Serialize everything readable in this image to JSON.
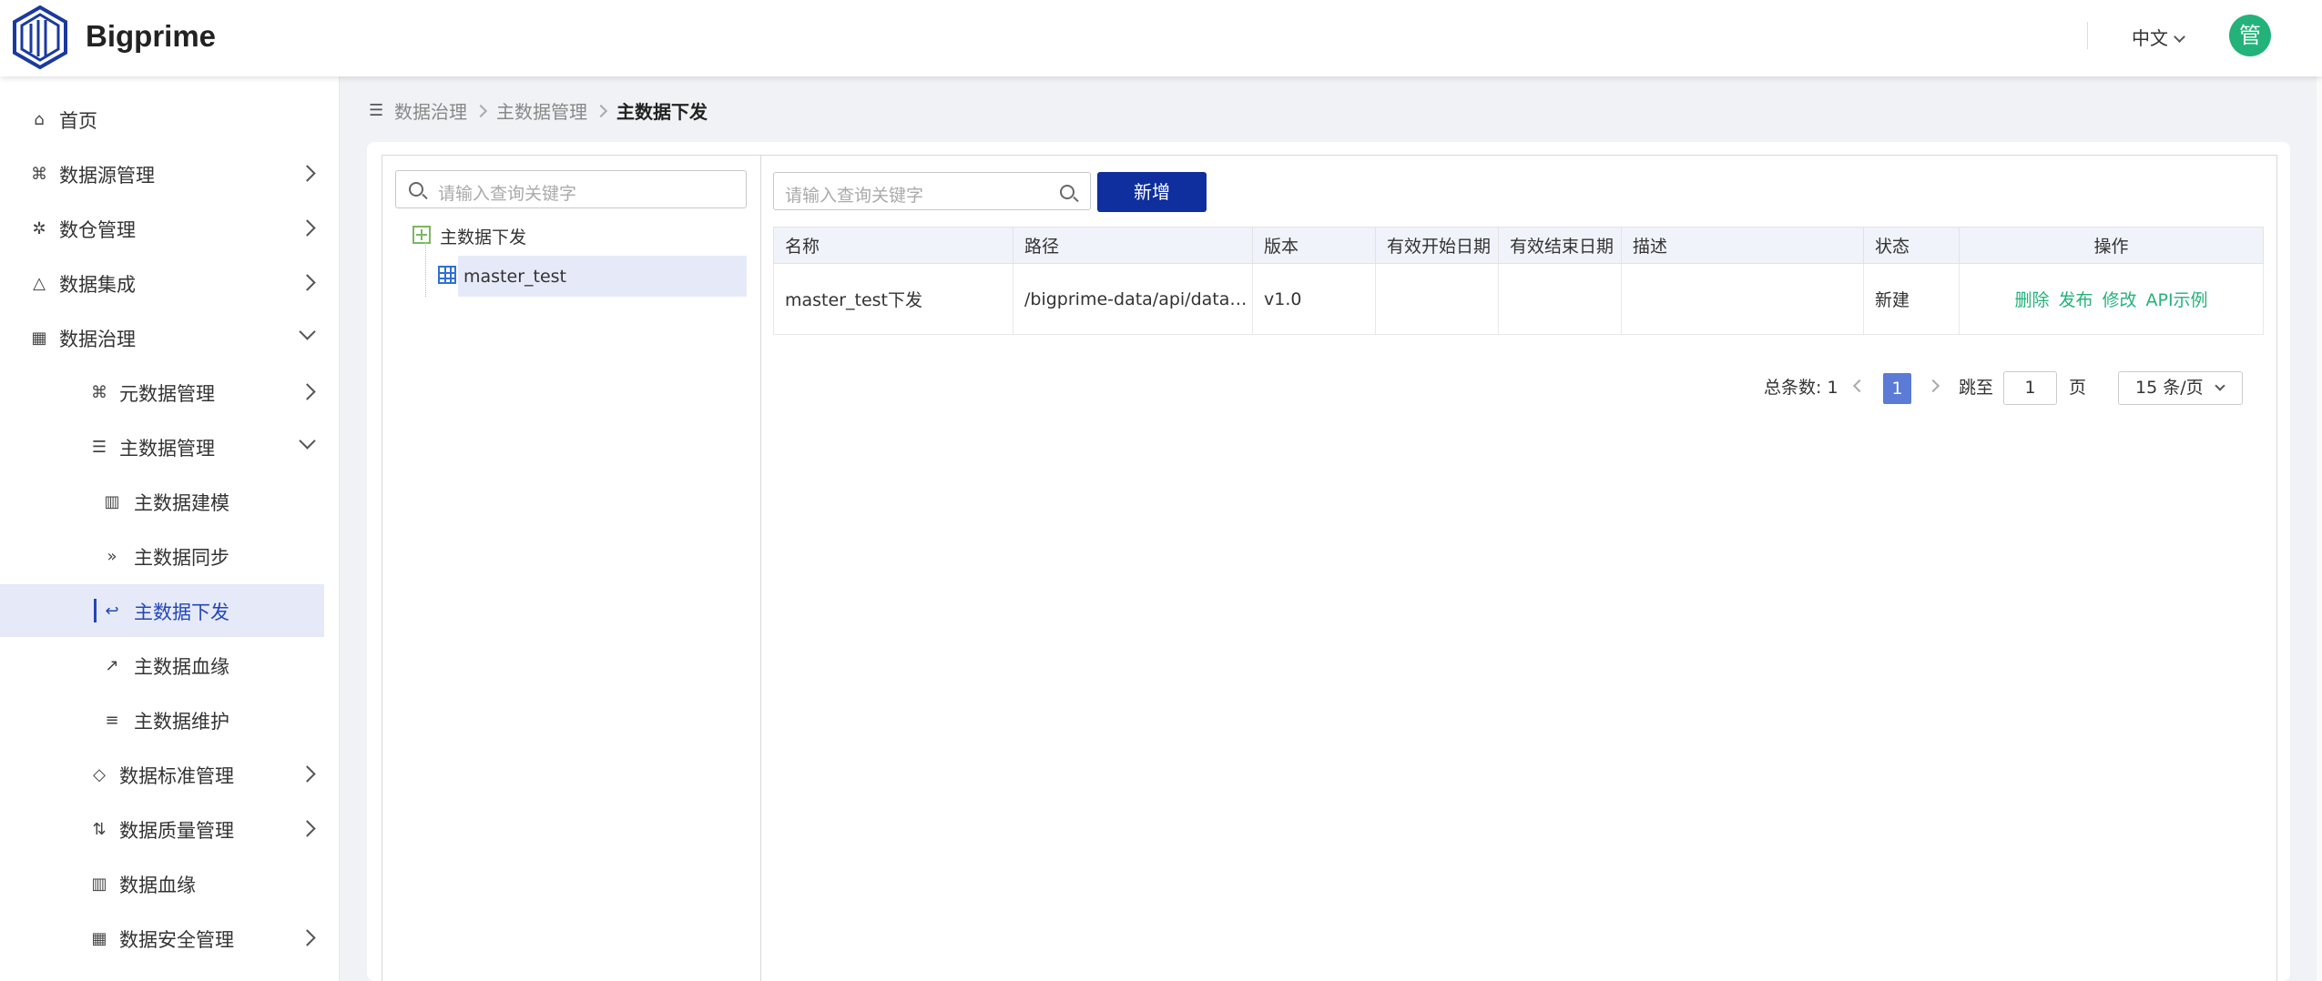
{
  "app": {
    "brand": "Bigprime",
    "language": "中文",
    "avatar_text": "管"
  },
  "sidebar": {
    "items": [
      {
        "label": "首页",
        "icon": "home-icon"
      },
      {
        "label": "数据源管理",
        "icon": "datasource-icon"
      },
      {
        "label": "数仓管理",
        "icon": "warehouse-icon"
      },
      {
        "label": "数据集成",
        "icon": "integration-icon"
      },
      {
        "label": "数据治理",
        "icon": "governance-icon"
      },
      {
        "label": "元数据管理",
        "icon": "metadata-icon"
      },
      {
        "label": "主数据管理",
        "icon": "sliders-icon"
      },
      {
        "label": "主数据建模",
        "icon": "bar-chart-icon"
      },
      {
        "label": "主数据同步",
        "icon": "double-chevron-icon"
      },
      {
        "label": "主数据下发",
        "icon": "reply-icon"
      },
      {
        "label": "主数据血缘",
        "icon": "line-chart-icon"
      },
      {
        "label": "主数据维护",
        "icon": "list-icon"
      },
      {
        "label": "数据标准管理",
        "icon": "eraser-icon"
      },
      {
        "label": "数据质量管理",
        "icon": "sort-icon"
      },
      {
        "label": "数据血缘",
        "icon": "bar-chart-icon"
      },
      {
        "label": "数据安全管理",
        "icon": "table-icon"
      }
    ]
  },
  "breadcrumb": {
    "items": [
      "数据治理",
      "主数据管理",
      "主数据下发"
    ]
  },
  "tree": {
    "search_placeholder": "请输入查询关键字",
    "root_label": "主数据下发",
    "child_label": "master_test"
  },
  "toolbar": {
    "search_placeholder": "请输入查询关键字",
    "add_label": "新增"
  },
  "table": {
    "columns": [
      "名称",
      "路径",
      "版本",
      "有效开始日期",
      "有效结束日期",
      "描述",
      "状态",
      "操作"
    ],
    "rows": [
      {
        "name": "master_test下发",
        "path": "/bigprime-data/api/data-ser…",
        "version": "v1.0",
        "start": "",
        "end": "",
        "desc": "",
        "status": "新建",
        "ops": [
          "删除",
          "发布",
          "修改",
          "API示例"
        ]
      }
    ]
  },
  "pagination": {
    "total_label": "总条数:",
    "total": "1",
    "current_page": "1",
    "goto_label": "跳至",
    "goto_value": "1",
    "page_unit": "页",
    "page_size": "15 条/页"
  },
  "colors": {
    "primary": "#0f2f9e",
    "accent_green": "#23b27a",
    "active_bg": "#e6eaf8"
  }
}
